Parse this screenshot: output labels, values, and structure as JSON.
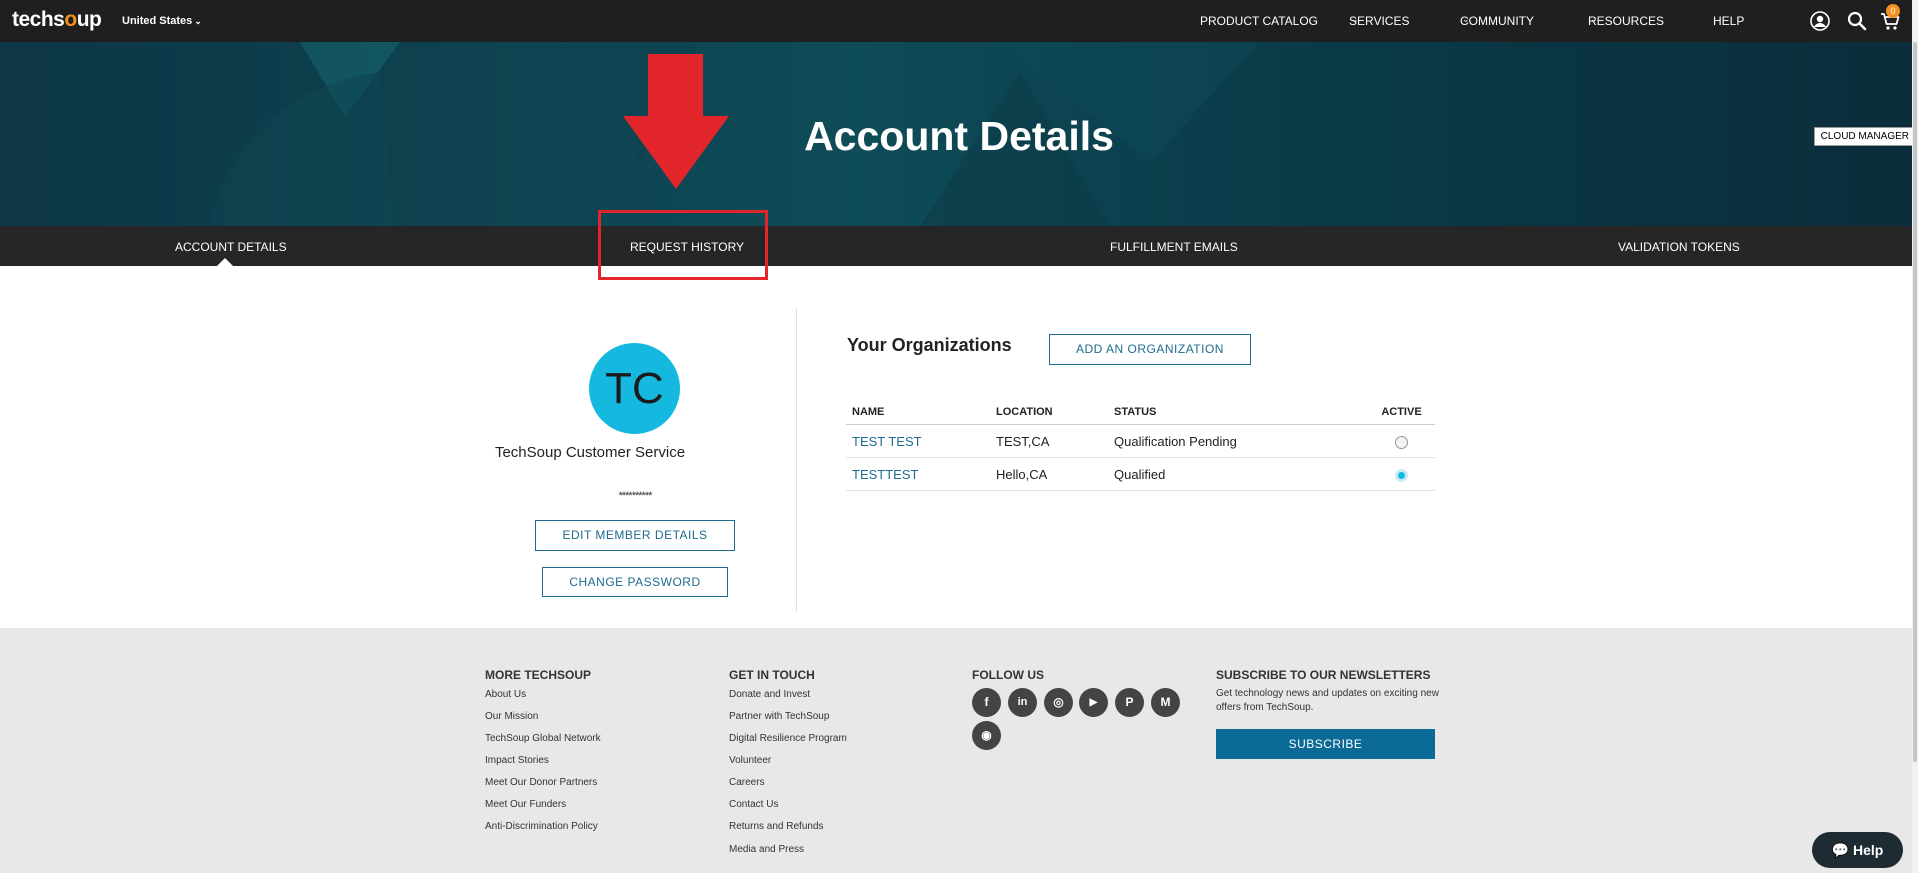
{
  "header": {
    "logo": {
      "text_main": "techs",
      "text_o": "o",
      "text_end": "up"
    },
    "country": "United States",
    "nav": [
      {
        "label": "PRODUCT CATALOG"
      },
      {
        "label": "SERVICES"
      },
      {
        "label": "COMMUNITY"
      },
      {
        "label": "RESOURCES"
      },
      {
        "label": "HELP"
      }
    ],
    "icons": [
      "user-icon",
      "search-icon",
      "cart-icon"
    ],
    "cart_count": "0"
  },
  "hero": {
    "title": "Account Details",
    "cloud_manager": "CLOUD MANAGER"
  },
  "tabs": [
    {
      "label": "ACCOUNT DETAILS",
      "active": true
    },
    {
      "label": "REQUEST HISTORY"
    },
    {
      "label": "FULFILLMENT EMAILS"
    },
    {
      "label": "VALIDATION TOKENS"
    }
  ],
  "member": {
    "initials": "TC",
    "name": "TechSoup Customer Service",
    "password_mask": "**********",
    "edit_button": "EDIT MEMBER DETAILS",
    "change_password_button": "CHANGE PASSWORD"
  },
  "organizations": {
    "title": "Your Organizations",
    "add_button": "ADD AN ORGANIZATION",
    "columns": [
      "NAME",
      "LOCATION",
      "STATUS",
      "ACTIVE"
    ],
    "rows": [
      {
        "name": "TEST TEST",
        "location": "TEST,CA",
        "status": "Qualification Pending",
        "active": false
      },
      {
        "name": "TESTTEST",
        "location": "Hello,CA",
        "status": "Qualified",
        "active": true
      }
    ]
  },
  "footer": {
    "more_techsoup": {
      "title": "MORE TECHSOUP",
      "links": [
        "About Us",
        "Our Mission",
        "TechSoup Global Network",
        "Impact Stories",
        "Meet Our Donor Partners",
        "Meet Our Funders",
        "Anti-Discrimination Policy"
      ]
    },
    "get_in_touch": {
      "title": "GET IN TOUCH",
      "links": [
        "Donate and Invest",
        "Partner with TechSoup",
        "Digital Resilience Program",
        "Volunteer",
        "Careers",
        "Contact Us",
        "Returns and Refunds",
        "Media and Press"
      ]
    },
    "follow_us": {
      "title": "FOLLOW US",
      "icons": [
        "facebook-icon",
        "linkedin-icon",
        "instagram-icon",
        "youtube-icon",
        "pinterest-icon",
        "medium-icon",
        "rss-icon"
      ],
      "glyphs": [
        "f",
        "in",
        "◎",
        "▶",
        "P",
        "M",
        "◉"
      ]
    },
    "newsletter": {
      "title": "SUBSCRIBE TO OUR NEWSLETTERS",
      "text": "Get technology news and updates on exciting new offers from TechSoup.",
      "button": "SUBSCRIBE"
    }
  },
  "help_button": "Help",
  "colors": {
    "accent": "#1d6b8f",
    "avatar": "#15b9e0",
    "annotation_red": "#e1252b",
    "brand_orange": "#f6901e"
  }
}
